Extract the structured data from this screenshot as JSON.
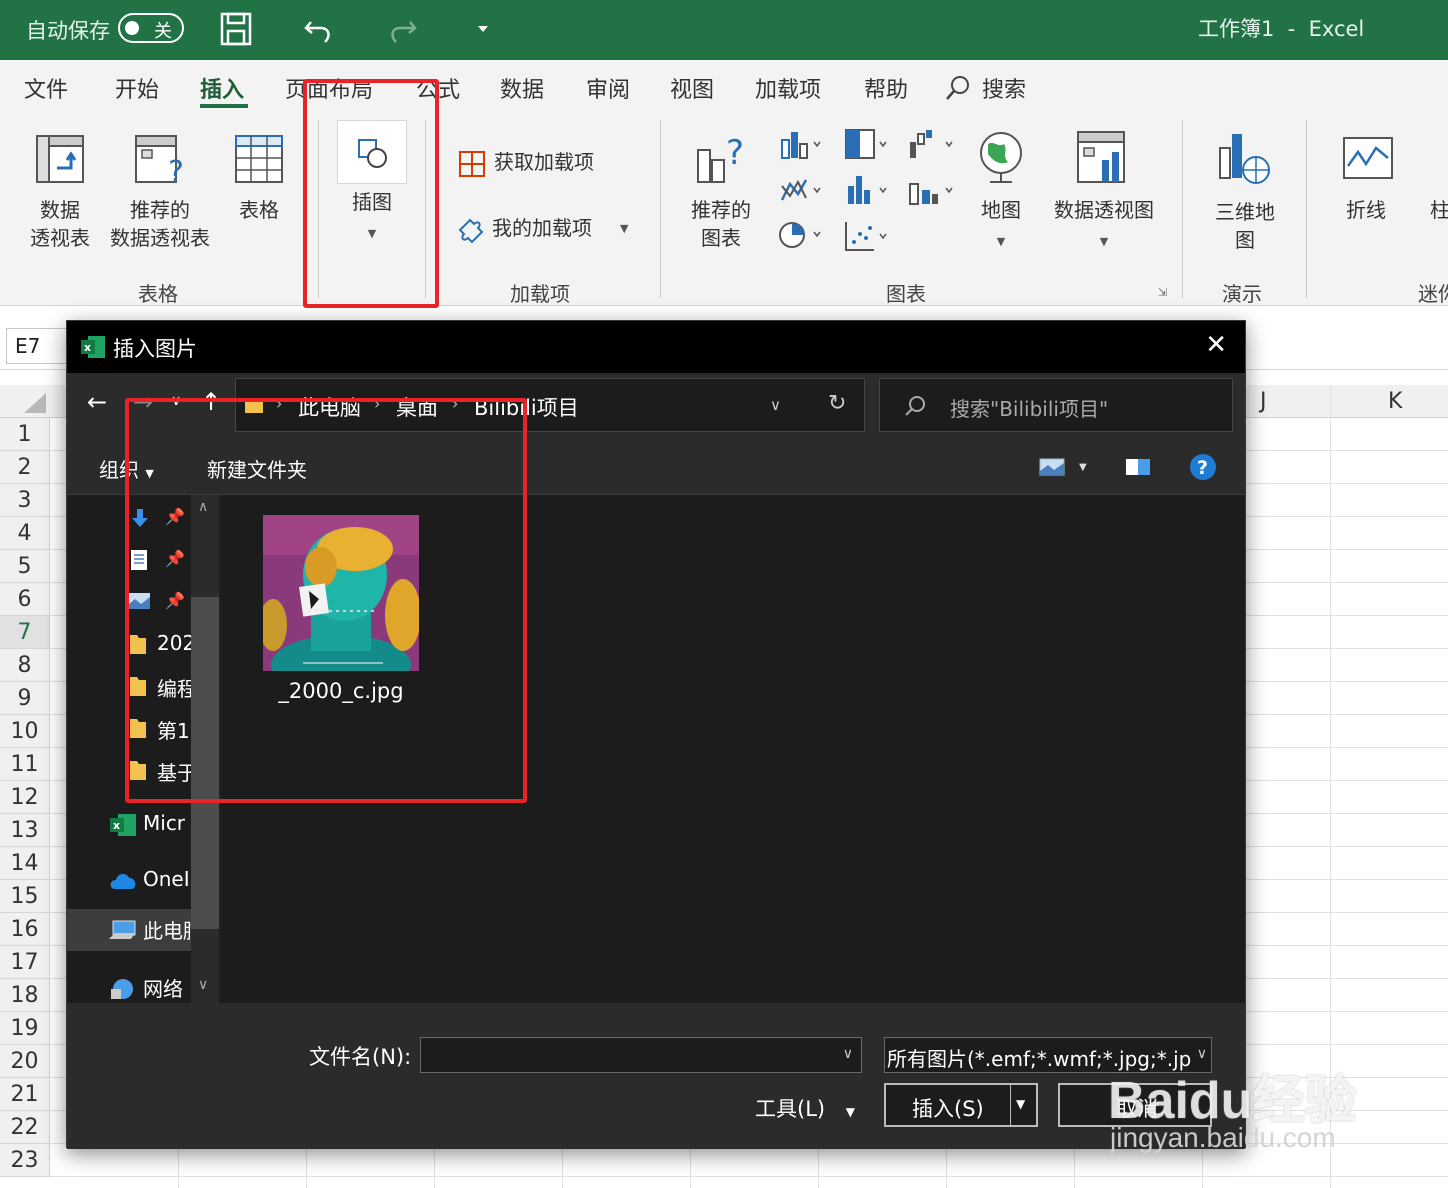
{
  "titlebar": {
    "autosave_label": "自动保存",
    "autosave_state": "关",
    "title": "工作簿1  -  Excel"
  },
  "menu": [
    "文件",
    "开始",
    "插入",
    "页面布局",
    "公式",
    "数据",
    "审阅",
    "视图",
    "加载项",
    "帮助",
    "搜索"
  ],
  "ribbon": {
    "pivot_table": "数据\n透视表",
    "rec_pivot": "推荐的\n数据透视表",
    "table": "表格",
    "group_tables": "表格",
    "illustrations": "插图",
    "get_addins": "获取加载项",
    "my_addins": "我的加载项",
    "group_addins": "加载项",
    "rec_charts": "推荐的\n图表",
    "maps": "地图",
    "pivot_chart": "数据透视图",
    "group_charts": "图表",
    "map3d": "三维地\n图",
    "group_tours": "演示",
    "line": "折线",
    "column_partial": "柱",
    "group_sparklines_partial": "迷你"
  },
  "sheet": {
    "name_box": "E7",
    "columns_visible": [
      "J",
      "K"
    ],
    "rows": [
      "1",
      "2",
      "3",
      "4",
      "5",
      "6",
      "7",
      "8",
      "9",
      "10",
      "11",
      "12",
      "13",
      "14",
      "15",
      "16",
      "17",
      "18",
      "19",
      "20",
      "21",
      "22",
      "23"
    ],
    "selected_row": "7"
  },
  "dialog": {
    "title": "插入图片",
    "breadcrumb": [
      "此电脑",
      "桌面",
      "Bilibili项目"
    ],
    "search_placeholder": "搜索\"Bilibili项目\"",
    "organize": "组织",
    "new_folder": "新建文件夹",
    "nav_items": [
      "202",
      "编程",
      "第1",
      "基于",
      "Micr",
      "OneI",
      "此电脑",
      "网络"
    ],
    "file_name_display": "_2000_c.jpg",
    "filename_label": "文件名(N):",
    "filename_value": "",
    "filter": "所有图片(*.emf;*.wmf;*.jpg;*.jp",
    "tools": "工具(L)",
    "insert": "插入(S)",
    "cancel": "取消"
  },
  "watermark": {
    "brand": "Baidu经验",
    "url": "jingyan.baidu.com"
  },
  "colors": {
    "excel_green": "#217346",
    "annotation_red": "#e8242a",
    "dialog_bg": "#202020"
  }
}
